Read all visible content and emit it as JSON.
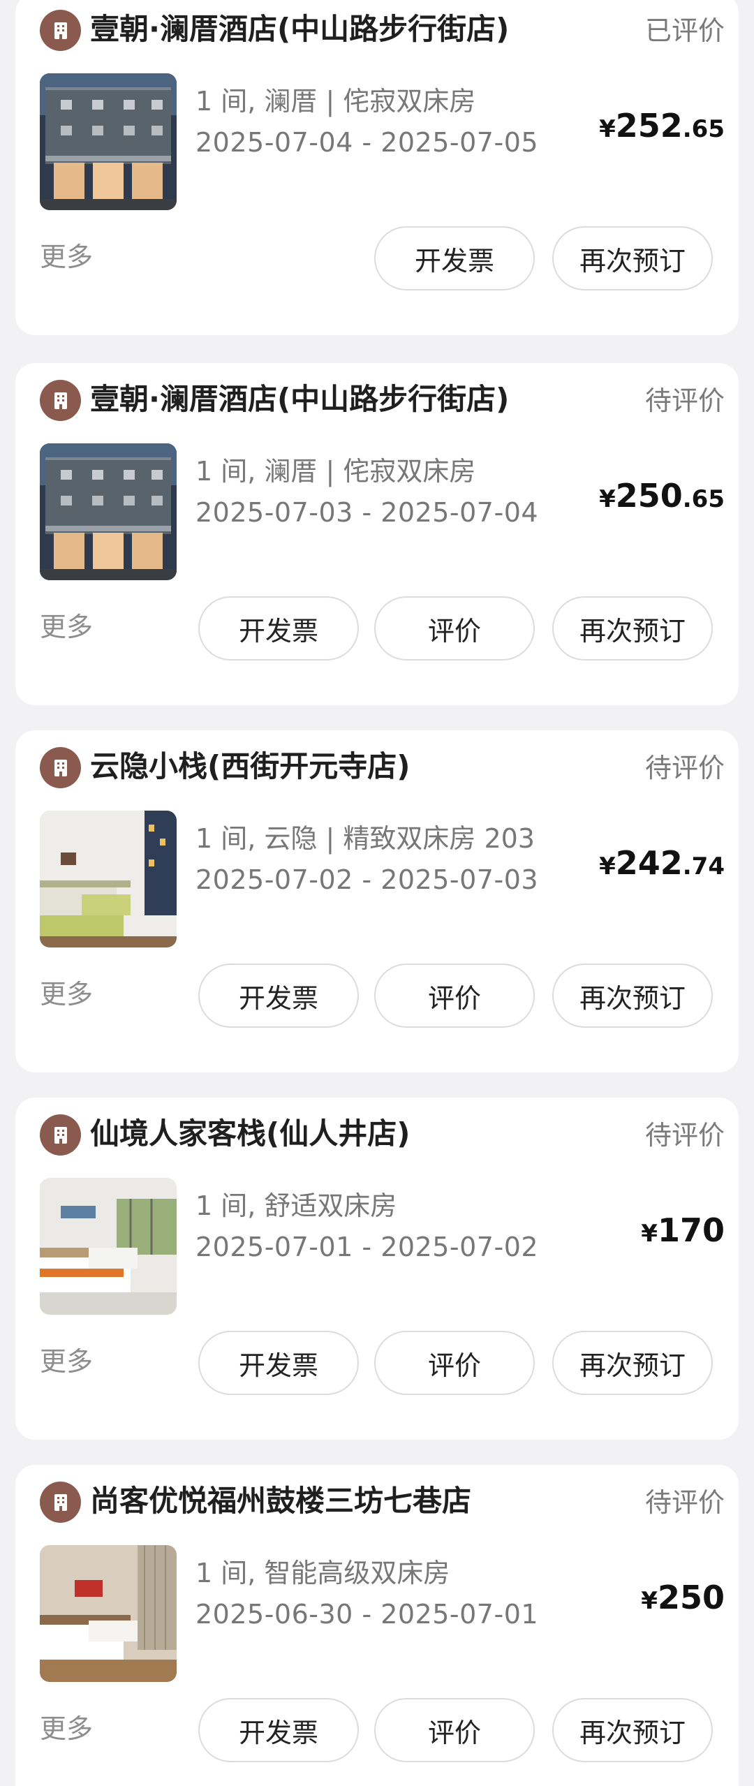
{
  "orders": [
    {
      "hotel_name": "壹朝·澜厝酒店(中山路步行街店)",
      "status": "已评价",
      "room_info": "1 间, 澜厝 | 侘寂双床房",
      "dates": "2025-07-04 - 2025-07-05",
      "price_currency": "¥",
      "price_int": "252",
      "price_dec": ".65",
      "more_label": "更多",
      "buttons": [
        "开发票",
        "再次预订"
      ],
      "thumb_style": "facade"
    },
    {
      "hotel_name": "壹朝·澜厝酒店(中山路步行街店)",
      "status": "待评价",
      "room_info": "1 间, 澜厝 | 侘寂双床房",
      "dates": "2025-07-03 - 2025-07-04",
      "price_currency": "¥",
      "price_int": "250",
      "price_dec": ".65",
      "more_label": "更多",
      "buttons": [
        "开发票",
        "评价",
        "再次预订"
      ],
      "thumb_style": "facade"
    },
    {
      "hotel_name": "云隐小栈(西街开元寺店)",
      "status": "待评价",
      "room_info": "1 间, 云隐 | 精致双床房 203",
      "dates": "2025-07-02 - 2025-07-03",
      "price_currency": "¥",
      "price_int": "242",
      "price_dec": ".74",
      "more_label": "更多",
      "buttons": [
        "开发票",
        "评价",
        "再次预订"
      ],
      "thumb_style": "room-green"
    },
    {
      "hotel_name": "仙境人家客栈(仙人井店)",
      "status": "待评价",
      "room_info": "1 间, 舒适双床房",
      "dates": "2025-07-01 - 2025-07-02",
      "price_currency": "¥",
      "price_int": "170",
      "price_dec": "",
      "more_label": "更多",
      "buttons": [
        "开发票",
        "评价",
        "再次预订"
      ],
      "thumb_style": "room-orange"
    },
    {
      "hotel_name": "尚客优悦福州鼓楼三坊七巷店",
      "status": "待评价",
      "room_info": "1 间, 智能高级双床房",
      "dates": "2025-06-30 - 2025-07-01",
      "price_currency": "¥",
      "price_int": "250",
      "price_dec": "",
      "more_label": "更多",
      "buttons": [
        "开发票",
        "评价",
        "再次预订"
      ],
      "thumb_style": "room-wood"
    }
  ],
  "colors": {
    "page_background": "#f2f2f4",
    "card_background": "#ffffff",
    "hotel_icon": "#8a5a4e",
    "muted_text": "#777777",
    "button_border": "#dcdcdc"
  },
  "icons": {
    "hotel": "building-icon"
  }
}
